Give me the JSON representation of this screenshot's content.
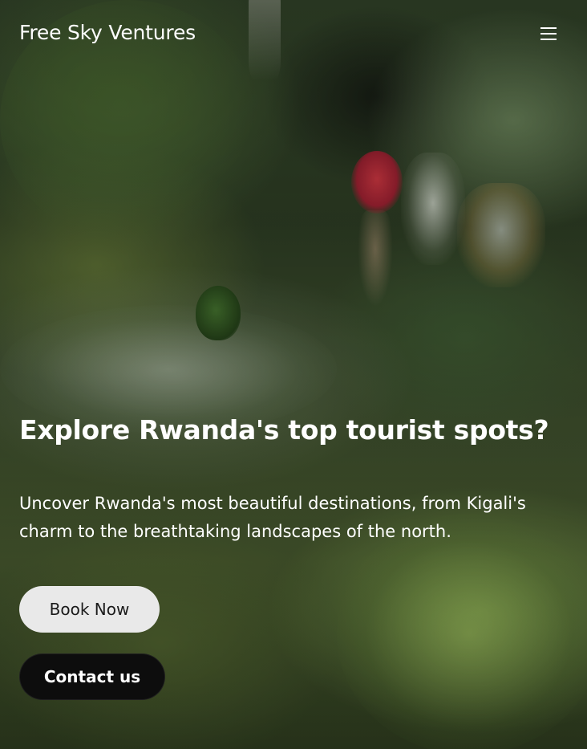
{
  "header": {
    "brand": "Free Sky Ventures",
    "menu_icon": "hamburger-menu-icon"
  },
  "hero": {
    "background_image": "hikers-on-forest-trail",
    "title": "Explore Rwanda's top tourist spots?",
    "description": "Uncover Rwanda's most beautiful destinations, from Kigali's charm to the breathtaking landscapes of the north.",
    "primary_button": "Book Now",
    "secondary_button": "Contact us"
  },
  "colors": {
    "text": "#ffffff",
    "primary_button_bg": "#e9e9e9",
    "primary_button_text": "#1a1a1a",
    "secondary_button_bg": "#0d0d0d",
    "secondary_button_text": "#ffffff"
  }
}
